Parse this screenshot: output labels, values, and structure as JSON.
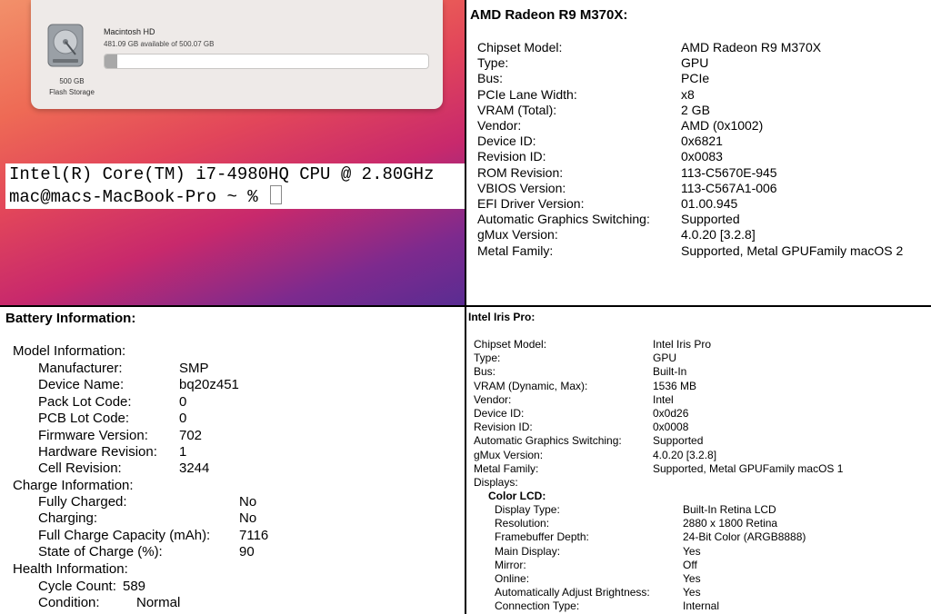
{
  "storage": {
    "volume_name": "Macintosh HD",
    "available": "481.09 GB available of 500.07 GB",
    "used_fraction": 0.038,
    "capacity_line1": "500 GB",
    "capacity_line2": "Flash Storage"
  },
  "terminal": {
    "line1": "Intel(R) Core(TM) i7-4980HQ CPU @ 2.80GHz",
    "line2": "mac@macs-MacBook-Pro ~ % "
  },
  "amd": {
    "title": "AMD Radeon R9 M370X:",
    "rows": [
      {
        "label": "Chipset Model:",
        "value": "AMD Radeon R9 M370X"
      },
      {
        "label": "Type:",
        "value": "GPU"
      },
      {
        "label": "Bus:",
        "value": "PCIe"
      },
      {
        "label": "PCIe Lane Width:",
        "value": "x8"
      },
      {
        "label": "VRAM (Total):",
        "value": "2 GB"
      },
      {
        "label": "Vendor:",
        "value": "AMD (0x1002)"
      },
      {
        "label": "Device ID:",
        "value": "0x6821"
      },
      {
        "label": "Revision ID:",
        "value": "0x0083"
      },
      {
        "label": "ROM Revision:",
        "value": "113-C5670E-945"
      },
      {
        "label": "VBIOS Version:",
        "value": "113-C567A1-006"
      },
      {
        "label": "EFI Driver Version:",
        "value": "01.00.945"
      },
      {
        "label": "Automatic Graphics Switching:",
        "value": "Supported"
      },
      {
        "label": "gMux Version:",
        "value": "4.0.20 [3.2.8]"
      },
      {
        "label": "Metal Family:",
        "value": "Supported, Metal GPUFamily macOS 2"
      }
    ]
  },
  "battery": {
    "title": "Battery Information:",
    "model_header": "Model Information:",
    "model_rows": [
      {
        "label": "Manufacturer:",
        "value": "SMP"
      },
      {
        "label": "Device Name:",
        "value": "bq20z451"
      },
      {
        "label": "Pack Lot Code:",
        "value": "0"
      },
      {
        "label": "PCB Lot Code:",
        "value": "0"
      },
      {
        "label": "Firmware Version:",
        "value": "702"
      },
      {
        "label": "Hardware Revision:",
        "value": "1"
      },
      {
        "label": "Cell Revision:",
        "value": "3244"
      }
    ],
    "charge_header": "Charge Information:",
    "charge_rows": [
      {
        "label": "Fully Charged:",
        "value": "No"
      },
      {
        "label": "Charging:",
        "value": "No"
      },
      {
        "label": "Full Charge Capacity (mAh):",
        "value": "7116"
      },
      {
        "label": "State of Charge (%):",
        "value": "90"
      }
    ],
    "health_header": "Health Information:",
    "health_rows": [
      {
        "label": "Cycle Count:",
        "value": "589"
      },
      {
        "label": "Condition:",
        "value": "Normal"
      }
    ]
  },
  "intel": {
    "title": "Intel Iris Pro:",
    "rows": [
      {
        "label": "Chipset Model:",
        "value": "Intel Iris Pro"
      },
      {
        "label": "Type:",
        "value": "GPU"
      },
      {
        "label": "Bus:",
        "value": "Built-In"
      },
      {
        "label": "VRAM (Dynamic, Max):",
        "value": "1536 MB"
      },
      {
        "label": "Vendor:",
        "value": "Intel"
      },
      {
        "label": "Device ID:",
        "value": "0x0d26"
      },
      {
        "label": "Revision ID:",
        "value": "0x0008"
      },
      {
        "label": "Automatic Graphics Switching:",
        "value": "Supported"
      },
      {
        "label": "gMux Version:",
        "value": "4.0.20 [3.2.8]"
      },
      {
        "label": "Metal Family:",
        "value": "Supported, Metal GPUFamily macOS 1"
      }
    ],
    "displays_header": "Displays:",
    "display_name": "Color LCD:",
    "display_rows": [
      {
        "label": "Display Type:",
        "value": "Built-In Retina LCD"
      },
      {
        "label": "Resolution:",
        "value": "2880 x 1800 Retina"
      },
      {
        "label": "Framebuffer Depth:",
        "value": "24-Bit Color (ARGB8888)"
      },
      {
        "label": "Main Display:",
        "value": "Yes"
      },
      {
        "label": "Mirror:",
        "value": "Off"
      },
      {
        "label": "Online:",
        "value": "Yes"
      },
      {
        "label": "Automatically Adjust Brightness:",
        "value": "Yes"
      },
      {
        "label": "Connection Type:",
        "value": "Internal"
      }
    ]
  }
}
